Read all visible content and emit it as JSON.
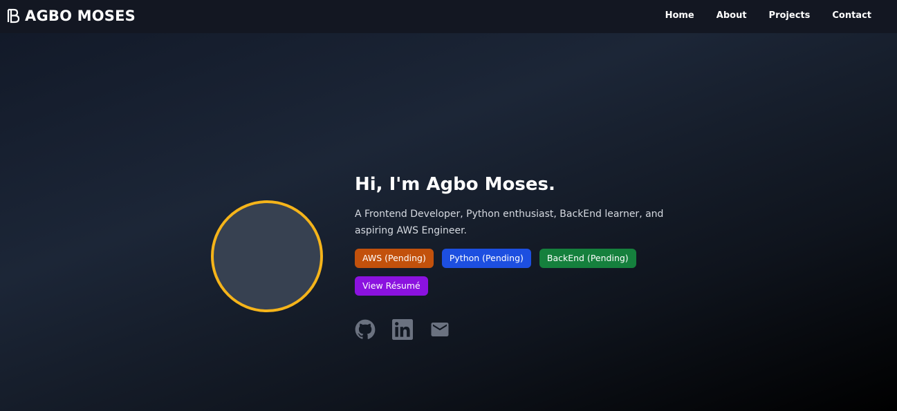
{
  "brand": {
    "name": "AGBO MOSES",
    "logo_icon": "logo-monogram-icon"
  },
  "nav": {
    "items": [
      {
        "label": "Home"
      },
      {
        "label": "About"
      },
      {
        "label": "Projects"
      },
      {
        "label": "Contact"
      }
    ]
  },
  "hero": {
    "greeting": "Hi, I'm Agbo Moses.",
    "tagline": "A Frontend Developer, Python enthusiast, BackEnd learner, and aspiring AWS Engineer.",
    "badges": [
      {
        "label": "AWS (Pending)",
        "color": "#c2510c"
      },
      {
        "label": "Python (Pending)",
        "color": "#1d4fe0"
      },
      {
        "label": "BackEnd (Pending)",
        "color": "#15803d"
      }
    ],
    "resume_button": {
      "label": "View Résumé",
      "color": "#8b12df"
    },
    "avatar_border_color": "#f5b41a"
  },
  "socials": [
    {
      "icon": "github-icon"
    },
    {
      "icon": "linkedin-icon"
    },
    {
      "icon": "email-icon"
    }
  ],
  "colors": {
    "nav_bg": "#131722",
    "icon_gray": "#6b7280"
  }
}
